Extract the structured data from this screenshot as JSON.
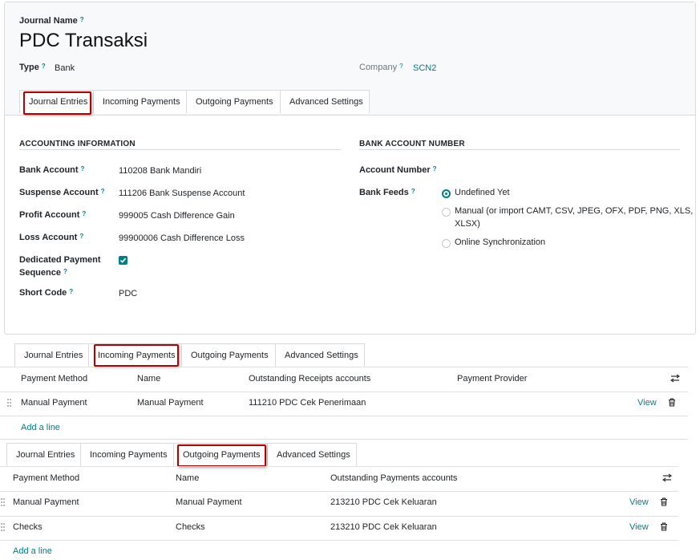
{
  "form": {
    "journal_name_label": "Journal Name",
    "journal_name": "PDC Transaksi",
    "type_label": "Type",
    "type_value": "Bank",
    "company_label": "Company",
    "company_value": "SCN2",
    "help": "?"
  },
  "tabs": [
    "Journal Entries",
    "Incoming Payments",
    "Outgoing Payments",
    "Advanced Settings"
  ],
  "accounting": {
    "title": "ACCOUNTING INFORMATION",
    "bank_account_label": "Bank Account",
    "bank_account": "110208 Bank Mandiri",
    "suspense_label": "Suspense Account",
    "suspense": "111206 Bank Suspense Account",
    "profit_label": "Profit Account",
    "profit": "999005 Cash Difference Gain",
    "loss_label": "Loss Account",
    "loss": "99900006 Cash Difference Loss",
    "dedicated_label_1": "Dedicated Payment",
    "dedicated_label_2": "Sequence",
    "dedicated_checked": true,
    "short_code_label": "Short Code",
    "short_code": "PDC"
  },
  "bank": {
    "title": "BANK ACCOUNT NUMBER",
    "account_number_label": "Account Number",
    "bank_feeds_label": "Bank Feeds",
    "feeds_options": [
      "Undefined Yet",
      "Manual (or import CAMT, CSV, JPEG, OFX, PDF, PNG, XLS,",
      "XLSX)",
      "Online Synchronization"
    ],
    "feeds_selected": "Undefined Yet"
  },
  "incoming": {
    "headers": [
      "Payment Method",
      "Name",
      "Outstanding Receipts accounts",
      "Payment Provider"
    ],
    "rows": [
      {
        "method": "Manual Payment",
        "name": "Manual Payment",
        "account": "111210 PDC Cek Penerimaan",
        "action": "View"
      }
    ],
    "add_line": "Add a line"
  },
  "outgoing": {
    "headers": [
      "Payment Method",
      "Name",
      "Outstanding Payments accounts"
    ],
    "rows": [
      {
        "method": "Manual Payment",
        "name": "Manual Payment",
        "account": "213210 PDC Cek Keluaran",
        "action": "View"
      },
      {
        "method": "Checks",
        "name": "Checks",
        "account": "213210 PDC Cek Keluaran",
        "action": "View"
      }
    ],
    "add_line": "Add a line"
  },
  "colors": {
    "accent": "#017e84",
    "highlight": "#b80000"
  }
}
